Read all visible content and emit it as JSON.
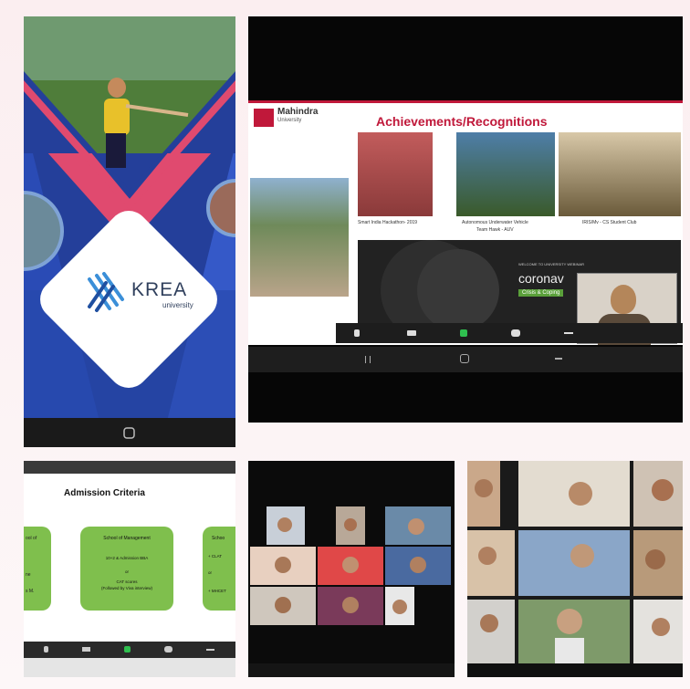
{
  "krea": {
    "logo_name": "KREA",
    "logo_sub": "university"
  },
  "mahindra": {
    "brand": "Mahindra",
    "brand_sub": "University",
    "slide_title": "Achievements/Recognitions",
    "photo_captions": [
      "Smart India Hackathon- 2019",
      "Autonomous Underwater Vehicle",
      "IRIS/Mv - CS Student Club"
    ],
    "caption_sub": "Team Hawk - AUV",
    "banner_text": "coronav",
    "banner_small": "WELCOME TO UNIVERSITY WEBINAR",
    "banner_tag": "Crisis & Coping"
  },
  "admission": {
    "title": "Admission Criteria",
    "center_card": {
      "heading": "School of Management",
      "line1": "10+2 & Admission BBA",
      "line2": "or",
      "line3": "CAT scores",
      "line4": "(Followed by Viva interview)"
    },
    "left_card": [
      "ool of",
      "ne",
      "s M."
    ],
    "right_card": [
      "Schoo",
      "+ CLAT",
      "or",
      "+ MHCET"
    ]
  },
  "colors": {
    "krea_blue": "#1f3f9c",
    "krea_accent": "#e64a6a",
    "green_card": "#7fbf4d",
    "zoom_green": "#2fbf4f",
    "slide_red": "#c0183a"
  }
}
